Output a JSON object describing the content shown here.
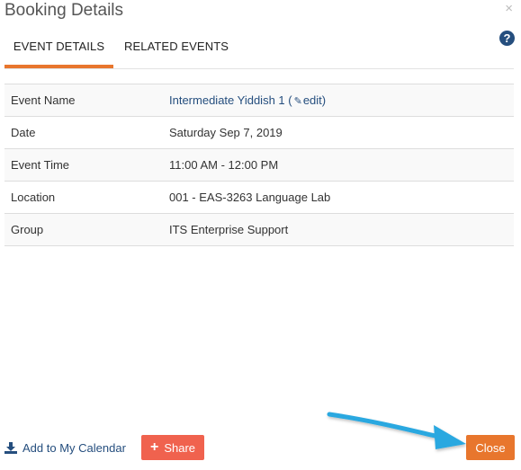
{
  "dialog": {
    "title": "Booking Details",
    "close_symbol": "×"
  },
  "tabs": [
    {
      "label": "EVENT DETAILS",
      "active": true
    },
    {
      "label": "RELATED EVENTS",
      "active": false
    }
  ],
  "help": {
    "symbol": "?",
    "icon": "question-circle-icon"
  },
  "details": [
    {
      "label": "Event Name",
      "value": "Intermediate Yiddish 1",
      "edit_label": "edit"
    },
    {
      "label": "Date",
      "value": "Saturday Sep 7, 2019"
    },
    {
      "label": "Event Time",
      "value": "11:00 AM - 12:00 PM"
    },
    {
      "label": "Location",
      "value": "001 - EAS-3263 Language Lab"
    },
    {
      "label": "Group",
      "value": "ITS Enterprise Support"
    }
  ],
  "footer": {
    "add_calendar_label": "Add to My Calendar",
    "share_label": "Share",
    "close_label": "Close"
  },
  "colors": {
    "accent": "#e8762d",
    "link": "#254e7e",
    "share": "#f0624e",
    "annotation_arrow": "#29a8e0"
  }
}
